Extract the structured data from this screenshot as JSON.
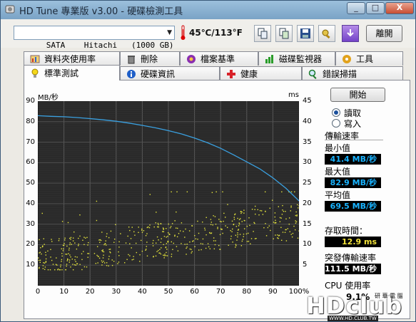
{
  "window": {
    "title": "HD Tune 專業版 v3.00 - 硬碟檢測工具",
    "minimize": "_",
    "maximize": "□",
    "close": "X"
  },
  "toolbar": {
    "drive": "SATA    Hitachi   (1000 GB)",
    "temperature": "45℃/113°F",
    "exit_label": "離開"
  },
  "tabs_top": [
    {
      "label": "資料夾使用率",
      "icon": "folder-chart-icon"
    },
    {
      "label": "刪除",
      "icon": "trash-icon"
    },
    {
      "label": "檔案基準",
      "icon": "file-benchmark-icon"
    },
    {
      "label": "磁碟監視器",
      "icon": "disk-monitor-icon"
    },
    {
      "label": "工具",
      "icon": "tools-icon"
    }
  ],
  "tabs_bottom": [
    {
      "label": "標準測試",
      "icon": "lightbulb-icon",
      "active": true
    },
    {
      "label": "硬碟資訊",
      "icon": "info-icon"
    },
    {
      "label": "健康",
      "icon": "health-cross-icon"
    },
    {
      "label": "錯誤掃描",
      "icon": "magnifier-icon"
    }
  ],
  "side": {
    "start_label": "開始",
    "read_label": "讀取",
    "write_label": "寫入",
    "mode_selected": "read",
    "transfer_rate_title": "傳輸速率",
    "min_label": "最小值",
    "min_value": "41.4 MB/秒",
    "max_label": "最大值",
    "max_value": "82.9 MB/秒",
    "avg_label": "平均值",
    "avg_value": "69.5 MB/秒",
    "access_label": "存取時間：",
    "access_value": "12.9 ms",
    "burst_label": "突發傳輸速率",
    "burst_value": "111.5 MB/秒",
    "cpu_label": "CPU 使用率",
    "cpu_value": "9.1%"
  },
  "watermark": {
    "logo": "HDclub",
    "caption": "研 華 電 腦",
    "url": "WWW.HD.CLUB.TW"
  },
  "chart_data": {
    "type": "line",
    "y_left_label": "MB/秒",
    "y_right_label": "ms",
    "y_left_ticks": [
      90,
      80,
      70,
      60,
      50,
      40,
      30,
      20,
      10
    ],
    "y_right_ticks": [
      45,
      40,
      35,
      30,
      25,
      20,
      15,
      10,
      5
    ],
    "x_ticks": [
      "0",
      "10",
      "20",
      "30",
      "40",
      "50",
      "60",
      "70",
      "80",
      "90",
      "100%"
    ],
    "ylim_left": [
      0,
      90
    ],
    "ylim_right": [
      0,
      45
    ],
    "xlim": [
      0,
      100
    ],
    "grid": true,
    "series": [
      {
        "color": "#3aa0e0",
        "x": [
          0,
          5,
          10,
          15,
          20,
          25,
          30,
          35,
          40,
          45,
          50,
          55,
          60,
          65,
          70,
          75,
          80,
          85,
          90,
          95,
          100
        ],
        "y": [
          82.9,
          82.6,
          82.4,
          82.0,
          81.5,
          80.9,
          80.2,
          79.3,
          78.2,
          77.0,
          75.6,
          74.0,
          72.0,
          69.7,
          67.0,
          63.8,
          60.4,
          57.0,
          52.6,
          47.5,
          41.4
        ]
      }
    ],
    "scatter_color": "#e6e63c",
    "access_time_band_ms": [
      4,
      20
    ]
  }
}
